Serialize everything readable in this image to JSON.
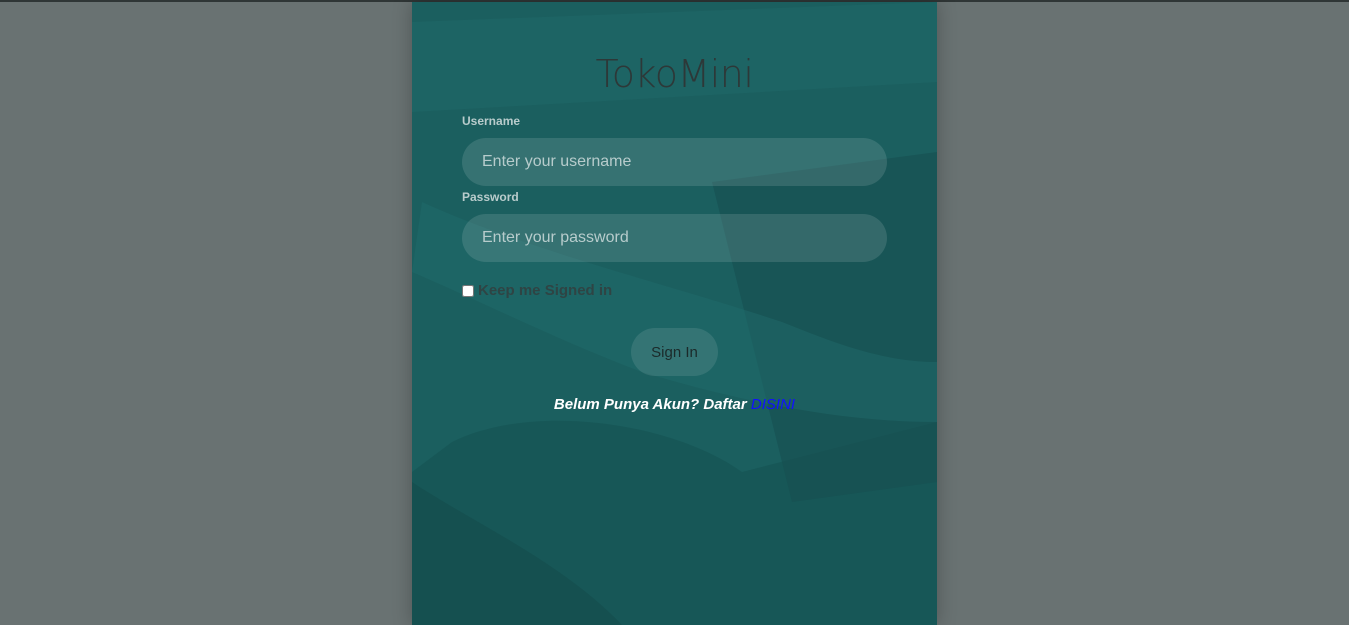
{
  "brand": {
    "title": "TokoMini"
  },
  "form": {
    "username_label": "Username",
    "username_placeholder": "Enter your username",
    "password_label": "Password",
    "password_placeholder": "Enter your password",
    "remember_label": "Keep me Signed in",
    "signin_label": "Sign In"
  },
  "register": {
    "prompt": "Belum Punya Akun? Daftar ",
    "link_label": "DISINI"
  },
  "colors": {
    "page_bg": "#697272",
    "panel_bg": "#1a5e5e",
    "link": "#1010ff"
  }
}
